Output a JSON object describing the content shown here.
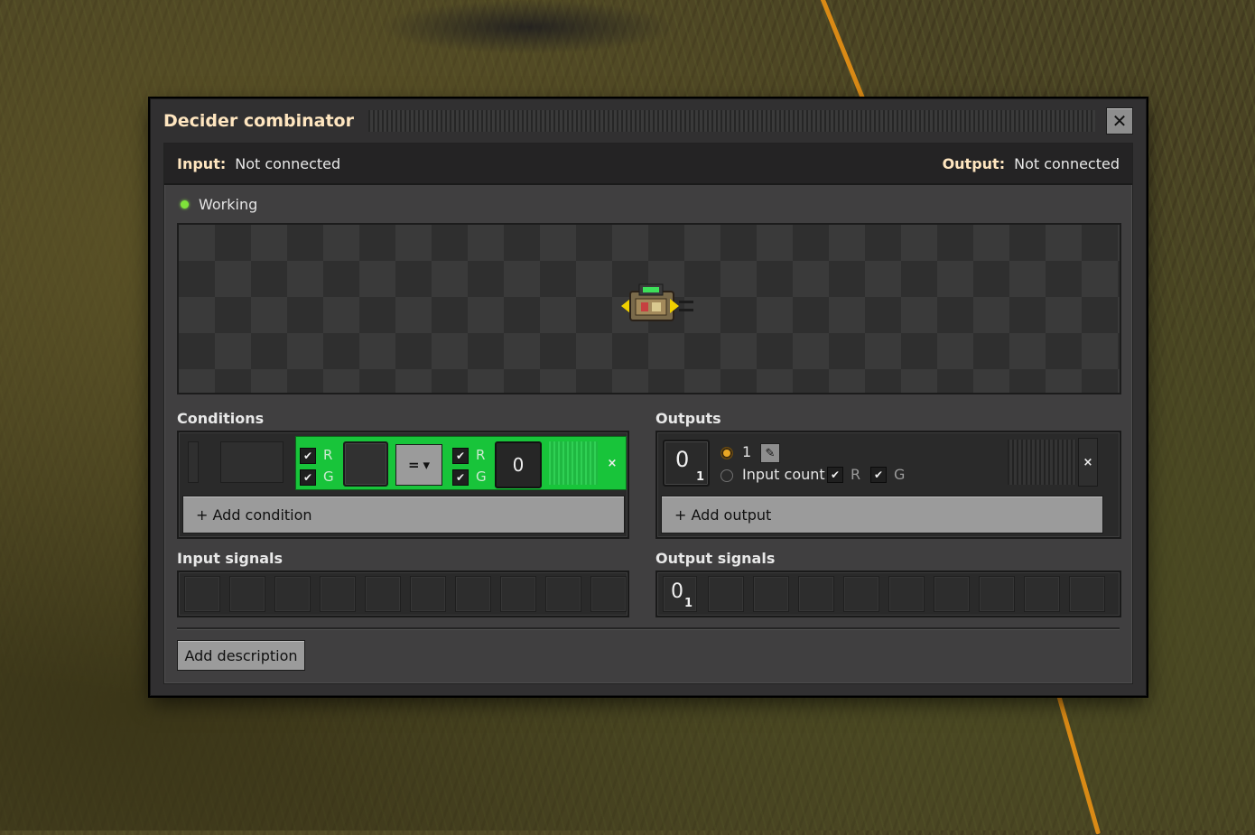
{
  "window": {
    "title": "Decider combinator",
    "close_symbol": "✕"
  },
  "connections": {
    "input_label": "Input:",
    "input_value": "Not connected",
    "output_label": "Output:",
    "output_value": "Not connected"
  },
  "status": {
    "text": "Working",
    "color": "#7fe23a"
  },
  "conditions": {
    "title": "Conditions",
    "left_wires": {
      "r": "R",
      "g": "G",
      "r_checked": true,
      "g_checked": true
    },
    "operator": "=",
    "right_wires": {
      "r": "R",
      "g": "G",
      "r_checked": true,
      "g_checked": true
    },
    "constant": "0",
    "remove_symbol": "×",
    "add_label": "+ Add condition",
    "active_color": "#18c43a"
  },
  "outputs": {
    "title": "Outputs",
    "signal_value": "0",
    "signal_count": "1",
    "option_one": "1",
    "option_input_count": "Input count",
    "wire_r": "R",
    "wire_g": "G",
    "remove_symbol": "×",
    "add_label": "+ Add output"
  },
  "input_signals": {
    "title": "Input signals",
    "empty_slots": 10
  },
  "output_signals": {
    "title": "Output signals",
    "first_value": "0",
    "first_count": "1",
    "empty_slots": 9
  },
  "footer": {
    "add_description": "Add description"
  }
}
